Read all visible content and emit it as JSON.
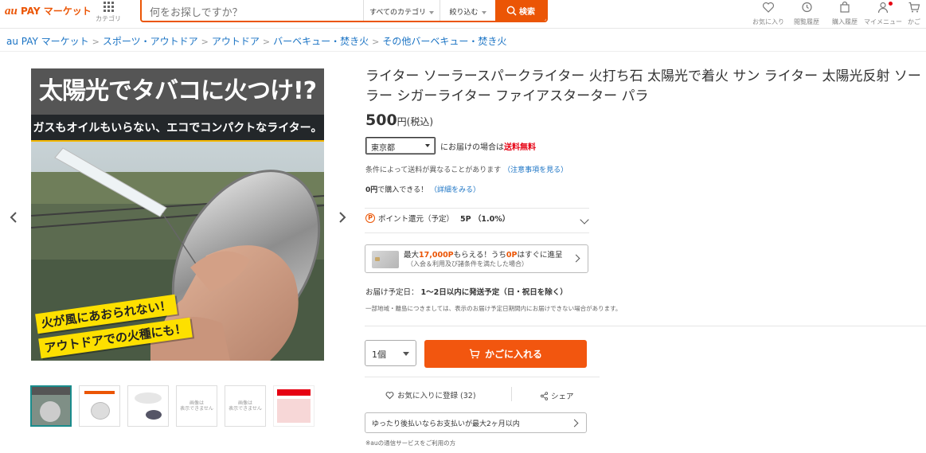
{
  "header": {
    "logo_au": "au",
    "logo_text": " PAY マーケット",
    "category_label": "カテゴリ",
    "search_placeholder": "何をお探しですか？",
    "category_select": "すべてのカテゴリ",
    "filter_select": "絞り込む",
    "search_button": "検索",
    "nav": [
      {
        "label": "お気に入り",
        "icon": "heart-icon"
      },
      {
        "label": "閲覧履歴",
        "icon": "history-icon"
      },
      {
        "label": "購入履歴",
        "icon": "bag-icon"
      },
      {
        "label": "マイメニュー",
        "icon": "person-icon"
      },
      {
        "label": "かご",
        "icon": "cart-icon"
      }
    ]
  },
  "breadcrumb": [
    "au PAY マーケット",
    "スポーツ・アウトドア",
    "アウトドア",
    "バーベキュー・焚き火",
    "その他バーベキュー・焚き火"
  ],
  "gallery": {
    "image_title": "太陽光でタバコに火つけ!?",
    "image_subtitle": "ガスもオイルもいらない、エコでコンパクトなライター。",
    "image_tag1": "火が風にあおられない！",
    "image_tag2": "アウトドアでの火種にも！",
    "thumb_placeholder": "画像は\n表示できません"
  },
  "product": {
    "title": "ライター ソーラースパークライター 火打ち石 太陽光で着火 サン ライター 太陽光反射 ソーラー シガーライター ファイアスターター パラ",
    "price": "500",
    "price_unit": "円(税込)",
    "prefecture": "東京都",
    "ship_text": "にお届けの場合は",
    "ship_free": "送料無料",
    "cond_text": "条件によって送料が異なることがあります",
    "cond_link": "（注意事項を見る）",
    "zero_amount": "0円",
    "zero_text": "で購入できる！",
    "zero_link": "（詳細をみる）",
    "points_label": "ポイント還元（予定）",
    "points_value": "5P （1.0%）",
    "card_l1_a": "最大",
    "card_l1_b": "17,000P",
    "card_l1_c": "もらえる！うち",
    "card_l1_d": "0P",
    "card_l1_e": "はすぐに進呈",
    "card_l2": "（入会＆利用及び諸条件を満たした場合）",
    "delivery_label": "お届け予定日：",
    "delivery_value": "1〜2日以内に発送予定（日・祝日を除く）",
    "delivery_note": "一部地域・離島につきましては、表示のお届け予定日期間内にお届けできない場合があります。",
    "qty": "1個",
    "cart_button": "かごに入れる",
    "favorite": "お気に入りに登録 (32)",
    "share": "シェア",
    "pay_later": "ゆったり後払いならお支払いが最大2ヶ月以内",
    "au_note": "※auの通信サービスをご利用の方"
  },
  "colors": {
    "accent": "#eb5505",
    "link": "#1a73c4",
    "free": "#e60012"
  }
}
